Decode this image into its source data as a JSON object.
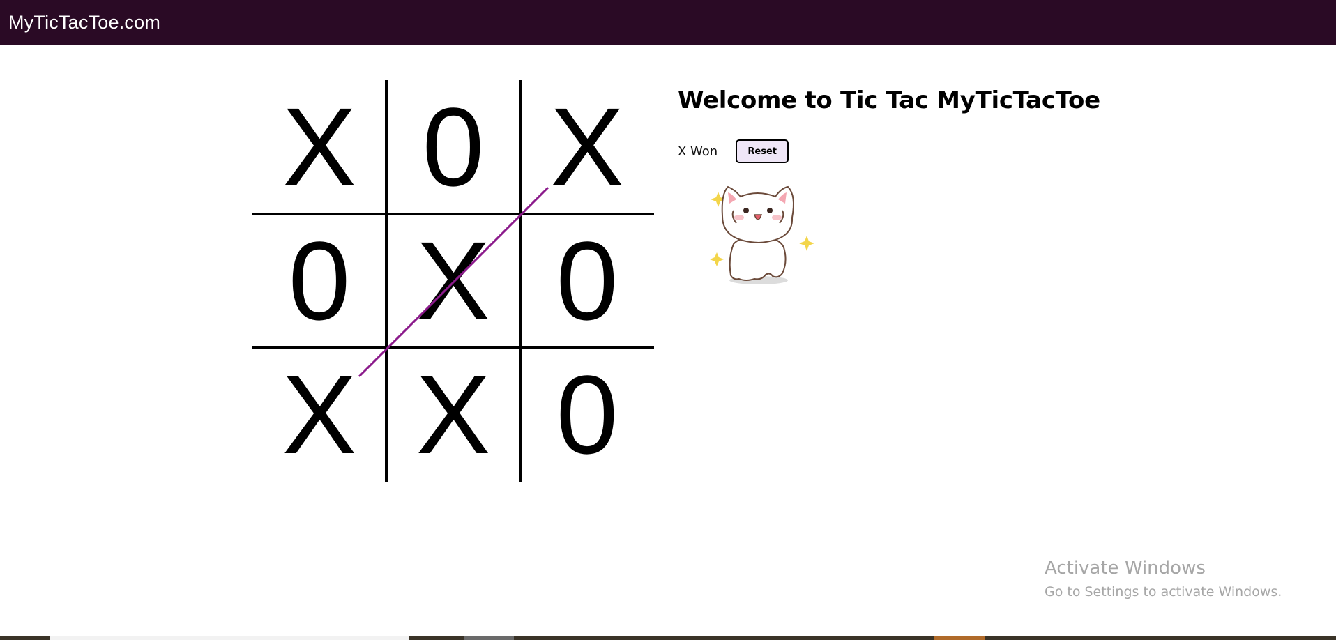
{
  "navbar": {
    "brand": "MyTicTacToe.com"
  },
  "board": {
    "cells": [
      "X",
      "0",
      "X",
      "0",
      "X",
      "0",
      "X",
      "X",
      "0"
    ],
    "winning_line_color": "#8b1a8b"
  },
  "info": {
    "title": "Welcome to Tic Tac MyTicTacToe",
    "status": "X Won",
    "reset_label": "Reset"
  },
  "watermark": {
    "title": "Activate Windows",
    "subtitle": "Go to Settings to activate Windows."
  },
  "colors": {
    "navbar": "#2a0a25",
    "reset_button_bg": "#efe6f7"
  },
  "icons": {
    "sticker": "happy-cat-icon"
  }
}
